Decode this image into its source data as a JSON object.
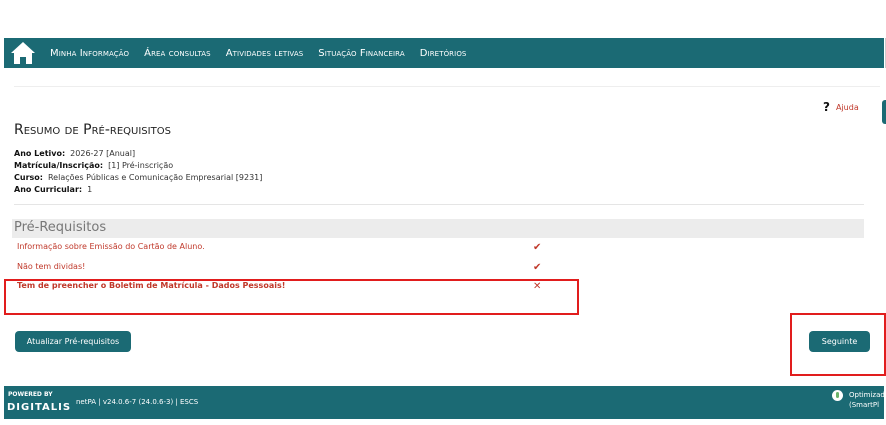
{
  "nav": {
    "items": [
      "Minha Informação",
      "Área consultas",
      "Atividades letivas",
      "Situação Financeira",
      "Diretórios"
    ]
  },
  "help": {
    "label": "Ajuda"
  },
  "page": {
    "title": "Resumo de Pré-requisitos"
  },
  "info": {
    "ano_letivo": {
      "label": "Ano Letivo:",
      "value": "2026-27 [Anual]"
    },
    "matricula": {
      "label": "Matrícula/Inscrição:",
      "value": "[1] Pré-inscrição"
    },
    "curso": {
      "label": "Curso:",
      "value": "Relações Públicas e Comunicação Empresarial [9231]"
    },
    "ano_curricular": {
      "label": "Ano Curricular:",
      "value": "1"
    }
  },
  "prereq": {
    "section_title": "Pré-Requisitos",
    "items": [
      {
        "text": "Informação sobre Emissão do Cartão de Aluno.",
        "status": "ok",
        "mark": "✔"
      },
      {
        "text": "Não tem dividas!",
        "status": "ok",
        "mark": "✔"
      },
      {
        "text": "Tem de preencher o Boletim de Matrícula - Dados Pessoais!",
        "status": "missing",
        "mark": "✕"
      }
    ]
  },
  "buttons": {
    "update": "Atualizar Pré-requisitos",
    "next": "Seguinte"
  },
  "footer": {
    "powered": "POWERED BY",
    "brand": "DIGITALIS",
    "version": "netPA | v24.0.6-7 (24.0.6-3) | ESCS",
    "optimized_line1": "Optimizad",
    "optimized_line2": "(SmartPl"
  },
  "colors": {
    "primary": "#1b6a74",
    "accent_red": "#c0392b",
    "highlight": "#e11d1d"
  }
}
